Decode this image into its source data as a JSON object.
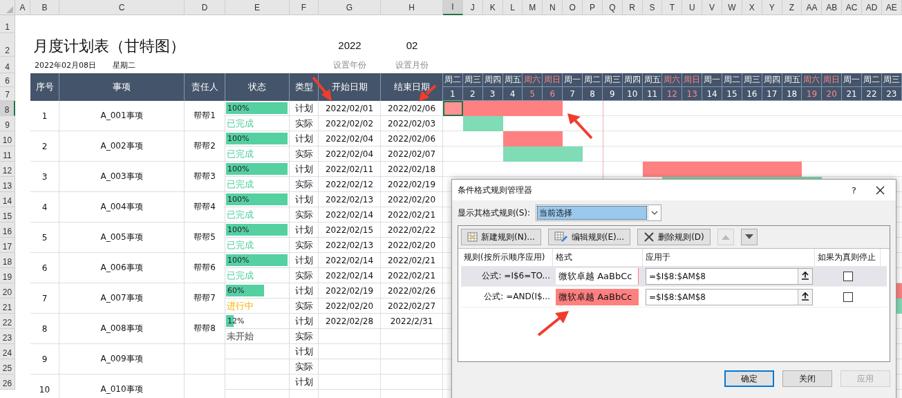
{
  "columns": [
    {
      "label": "A",
      "selected": false
    },
    {
      "label": "B",
      "selected": false
    },
    {
      "label": "C",
      "selected": false
    },
    {
      "label": "D",
      "selected": false
    },
    {
      "label": "E",
      "selected": false
    },
    {
      "label": "F",
      "selected": false
    },
    {
      "label": "G",
      "selected": false
    },
    {
      "label": "H",
      "selected": false
    },
    {
      "label": "I",
      "selected": true
    },
    {
      "label": "J",
      "selected": false
    },
    {
      "label": "K",
      "selected": false
    },
    {
      "label": "L",
      "selected": false
    },
    {
      "label": "M",
      "selected": false
    },
    {
      "label": "N",
      "selected": false
    },
    {
      "label": "O",
      "selected": false
    },
    {
      "label": "P",
      "selected": false
    },
    {
      "label": "Q",
      "selected": false
    },
    {
      "label": "R",
      "selected": false
    },
    {
      "label": "S",
      "selected": false
    },
    {
      "label": "T",
      "selected": false
    },
    {
      "label": "U",
      "selected": false
    },
    {
      "label": "V",
      "selected": false
    },
    {
      "label": "W",
      "selected": false
    },
    {
      "label": "X",
      "selected": false
    },
    {
      "label": "Y",
      "selected": false
    },
    {
      "label": "Z",
      "selected": false
    },
    {
      "label": "AA",
      "selected": false
    },
    {
      "label": "AB",
      "selected": false
    },
    {
      "label": "AC",
      "selected": false
    },
    {
      "label": "AD",
      "selected": false
    },
    {
      "label": "AE",
      "selected": false
    }
  ],
  "rows": [
    {
      "label": "1",
      "selected": false
    },
    {
      "label": "2",
      "selected": false
    },
    {
      "label": "4",
      "selected": false
    },
    {
      "label": "6",
      "selected": false
    },
    {
      "label": "7",
      "selected": false
    },
    {
      "label": "8",
      "selected": true
    },
    {
      "label": "9",
      "selected": false
    },
    {
      "label": "10",
      "selected": false
    },
    {
      "label": "11",
      "selected": false
    },
    {
      "label": "12",
      "selected": false
    },
    {
      "label": "13",
      "selected": false
    },
    {
      "label": "14",
      "selected": false
    },
    {
      "label": "15",
      "selected": false
    },
    {
      "label": "16",
      "selected": false
    },
    {
      "label": "17",
      "selected": false
    },
    {
      "label": "18",
      "selected": false
    },
    {
      "label": "19",
      "selected": false
    },
    {
      "label": "20",
      "selected": false
    },
    {
      "label": "21",
      "selected": false
    },
    {
      "label": "22",
      "selected": false
    },
    {
      "label": "23",
      "selected": false
    },
    {
      "label": "24",
      "selected": false
    },
    {
      "label": "25",
      "selected": false
    },
    {
      "label": "26",
      "selected": false
    }
  ],
  "title": "月度计划表（甘特图）",
  "date": "2022年02月08日",
  "weekday": "星期二",
  "year": {
    "value": "2022",
    "label": "设置年份"
  },
  "month": {
    "value": "02",
    "label": "设置月份"
  },
  "headers": [
    "序号",
    "事项",
    "责任人",
    "状态",
    "类型",
    "开始日期",
    "结束日期"
  ],
  "days": [
    {
      "weekday": "周二",
      "day": "1",
      "weekend": false
    },
    {
      "weekday": "周三",
      "day": "2",
      "weekend": false
    },
    {
      "weekday": "周四",
      "day": "3",
      "weekend": false
    },
    {
      "weekday": "周五",
      "day": "4",
      "weekend": false
    },
    {
      "weekday": "周六",
      "day": "5",
      "weekend": true
    },
    {
      "weekday": "周日",
      "day": "6",
      "weekend": true
    },
    {
      "weekday": "周一",
      "day": "7",
      "weekend": false
    },
    {
      "weekday": "周二",
      "day": "8",
      "weekend": false
    },
    {
      "weekday": "周三",
      "day": "9",
      "weekend": false
    },
    {
      "weekday": "周四",
      "day": "10",
      "weekend": false
    },
    {
      "weekday": "周五",
      "day": "11",
      "weekend": false
    },
    {
      "weekday": "周六",
      "day": "12",
      "weekend": true
    },
    {
      "weekday": "周日",
      "day": "13",
      "weekend": true
    },
    {
      "weekday": "周一",
      "day": "14",
      "weekend": false
    },
    {
      "weekday": "周二",
      "day": "15",
      "weekend": false
    },
    {
      "weekday": "周三",
      "day": "16",
      "weekend": false
    },
    {
      "weekday": "周四",
      "day": "17",
      "weekend": false
    },
    {
      "weekday": "周五",
      "day": "18",
      "weekend": false
    },
    {
      "weekday": "周六",
      "day": "19",
      "weekend": true
    },
    {
      "weekday": "周日",
      "day": "20",
      "weekend": true
    },
    {
      "weekday": "周一",
      "day": "21",
      "weekend": false
    },
    {
      "weekday": "周二",
      "day": "22",
      "weekend": false
    },
    {
      "weekday": "周三",
      "day": "23",
      "weekend": false
    }
  ],
  "tasks": [
    {
      "no": "1",
      "name": "A_001事项",
      "owner": "帮帮1",
      "progress": {
        "level": 1,
        "text": "100%"
      },
      "status": {
        "kind": "done",
        "text": "已完成"
      },
      "plan": {
        "type": "计划",
        "start": "2022/02/01",
        "end": "2022/02/06"
      },
      "actual": {
        "type": "实际",
        "start": "2022/02/02",
        "end": "2022/02/03"
      }
    },
    {
      "no": "2",
      "name": "A_002事项",
      "owner": "帮帮2",
      "progress": {
        "level": 1,
        "text": "100%"
      },
      "status": {
        "kind": "done",
        "text": "已完成"
      },
      "plan": {
        "type": "计划",
        "start": "2022/02/04",
        "end": "2022/02/06"
      },
      "actual": {
        "type": "实际",
        "start": "2022/02/04",
        "end": "2022/02/07"
      }
    },
    {
      "no": "3",
      "name": "A_003事项",
      "owner": "帮帮3",
      "progress": {
        "level": 1,
        "text": "100%"
      },
      "status": {
        "kind": "done",
        "text": "已完成"
      },
      "plan": {
        "type": "计划",
        "start": "2022/02/11",
        "end": "2022/02/18"
      },
      "actual": {
        "type": "实际",
        "start": "2022/02/12",
        "end": "2022/02/19"
      }
    },
    {
      "no": "4",
      "name": "A_004事项",
      "owner": "帮帮4",
      "progress": {
        "level": 1,
        "text": "100%"
      },
      "status": {
        "kind": "done",
        "text": "已完成"
      },
      "plan": {
        "type": "计划",
        "start": "2022/02/13",
        "end": "2022/02/20"
      },
      "actual": {
        "type": "实际",
        "start": "2022/02/14",
        "end": "2022/02/21"
      }
    },
    {
      "no": "5",
      "name": "A_005事项",
      "owner": "帮帮5",
      "progress": {
        "level": 1,
        "text": "100%"
      },
      "status": {
        "kind": "done",
        "text": "已完成"
      },
      "plan": {
        "type": "计划",
        "start": "2022/02/15",
        "end": "2022/02/22"
      },
      "actual": {
        "type": "实际",
        "start": "2022/02/13",
        "end": "2022/02/20"
      }
    },
    {
      "no": "6",
      "name": "A_006事项",
      "owner": "帮帮6",
      "progress": {
        "level": 1,
        "text": "100%"
      },
      "status": {
        "kind": "done",
        "text": "已完成"
      },
      "plan": {
        "type": "计划",
        "start": "2022/02/14",
        "end": "2022/02/21"
      },
      "actual": {
        "type": "实际",
        "start": "2022/02/14",
        "end": "2022/02/21"
      }
    },
    {
      "no": "7",
      "name": "A_007事项",
      "owner": "帮帮7",
      "progress": {
        "level": 0.6,
        "text": "60%"
      },
      "status": {
        "kind": "in_progress",
        "text": "进行中"
      },
      "plan": {
        "type": "计划",
        "start": "2022/02/19",
        "end": "2022/02/26"
      },
      "actual": {
        "type": "实际",
        "start": "2022/02/20",
        "end": "2022/02/27"
      }
    },
    {
      "no": "8",
      "name": "A_008事项",
      "owner": "帮帮8",
      "progress": {
        "level": 0.12,
        "text": "12%"
      },
      "status": {
        "kind": "not_started",
        "text": "未开始"
      },
      "plan": {
        "type": "计划",
        "start": "2022/02/28",
        "end": "2022/2/31"
      },
      "actual": {
        "type": "实际"
      }
    },
    {
      "no": "9",
      "name": "A_009事项",
      "plan": {
        "type": "计划"
      },
      "actual": {
        "type": "实际"
      }
    },
    {
      "no": "10",
      "name": "A_010事项",
      "plan": {
        "type": "计划"
      }
    }
  ],
  "dialog": {
    "title": "条件格式规则管理器",
    "help": "?",
    "show_label": "显示其格式规则(S):",
    "show_value": "当前选择",
    "toolbar": [
      {
        "kind": "new",
        "label": "新建规则(N)..."
      },
      {
        "kind": "edit",
        "label": "编辑规则(E)..."
      },
      {
        "kind": "delete",
        "label": "删除规则(D)"
      },
      {
        "kind": "up",
        "disabled": true
      },
      {
        "kind": "down",
        "disabled": false
      }
    ],
    "columns": [
      "规则(按所示顺序应用)",
      "格式",
      "应用于",
      "如果为真则停止"
    ],
    "rules": [
      {
        "rule": "公式: =I$6=TO...",
        "preview": "微软卓越  AaBbCc",
        "applies_to": "=$I$8:$AM$8",
        "stop": false,
        "selected": true
      },
      {
        "rule": "公式: =AND(I$...",
        "preview": "微软卓越  AaBbCc",
        "color": "#ff8080",
        "applies_to": "=$I$8:$AM$8",
        "stop": false,
        "selected": false
      }
    ],
    "buttons": [
      {
        "label": "确定",
        "default": true,
        "disabled": false
      },
      {
        "label": "关闭",
        "default": false,
        "disabled": false
      },
      {
        "label": "应用",
        "default": false,
        "disabled": true
      }
    ]
  }
}
